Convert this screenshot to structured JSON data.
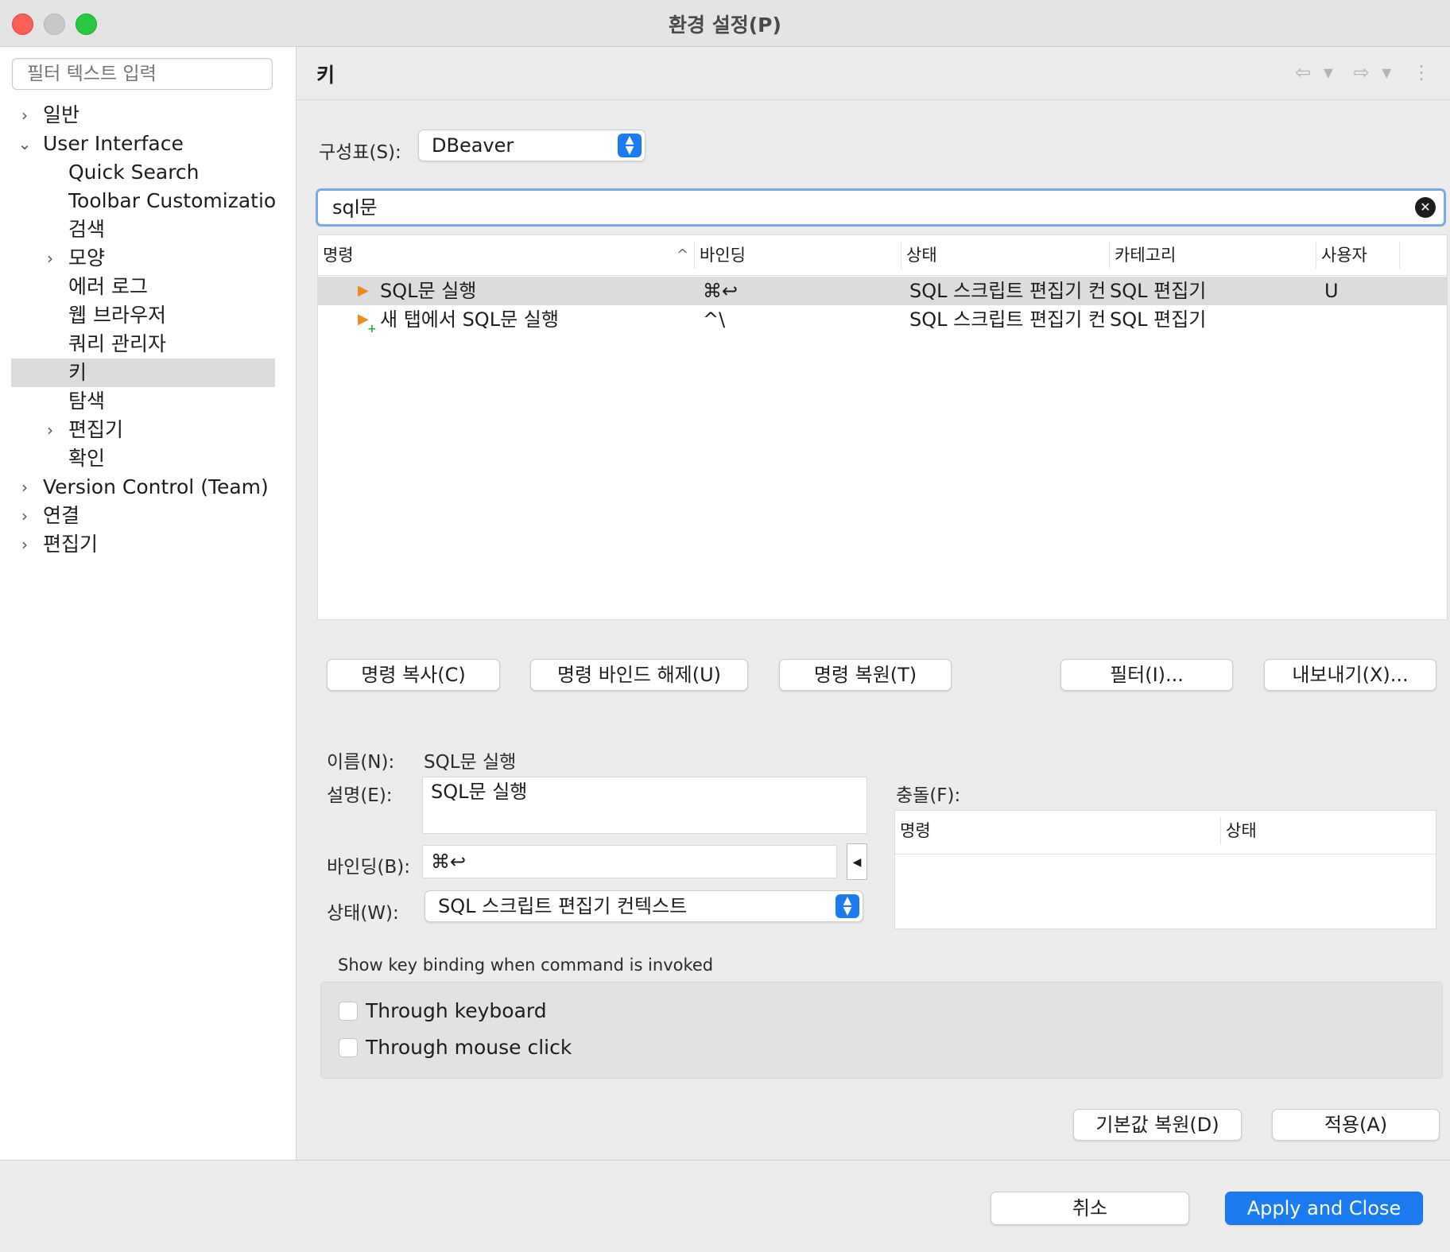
{
  "window": {
    "title": "환경 설정(P)"
  },
  "sidebar": {
    "filter_placeholder": "필터 텍스트 입력",
    "items": [
      {
        "label": "일반",
        "level": 0,
        "chevron": "›"
      },
      {
        "label": "User Interface",
        "level": 0,
        "chevron": "⌄"
      },
      {
        "label": "Quick Search",
        "level": 1,
        "chevron": ""
      },
      {
        "label": "Toolbar Customization",
        "level": 1,
        "chevron": ""
      },
      {
        "label": "검색",
        "level": 1,
        "chevron": ""
      },
      {
        "label": "모양",
        "level": 1,
        "chevron": "›"
      },
      {
        "label": "에러 로그",
        "level": 1,
        "chevron": ""
      },
      {
        "label": "웹 브라우저",
        "level": 1,
        "chevron": ""
      },
      {
        "label": "쿼리 관리자",
        "level": 1,
        "chevron": ""
      },
      {
        "label": "키",
        "level": 1,
        "chevron": "",
        "selected": true
      },
      {
        "label": "탐색",
        "level": 1,
        "chevron": ""
      },
      {
        "label": "편집기",
        "level": 1,
        "chevron": "›"
      },
      {
        "label": "확인",
        "level": 1,
        "chevron": ""
      },
      {
        "label": "Version Control (Team)",
        "level": 0,
        "chevron": "›"
      },
      {
        "label": "연결",
        "level": 0,
        "chevron": "›"
      },
      {
        "label": "편집기",
        "level": 0,
        "chevron": "›"
      }
    ]
  },
  "main": {
    "title": "키",
    "nav": {
      "back": "⇦ ▾",
      "forward": "⇨ ▾",
      "more": "⋮"
    },
    "scheme": {
      "label": "구성표(S):",
      "value": "DBeaver"
    },
    "search": {
      "value": "sql문"
    },
    "table": {
      "columns": [
        "명령",
        "바인딩",
        "상태",
        "카테고리",
        "사용자"
      ],
      "sort_indicator": "^",
      "rows": [
        {
          "command": "SQL문 실행",
          "binding": "⌘↩",
          "when": "SQL 스크립트 편집기 컨",
          "category": "SQL 편집기",
          "user": "U",
          "selected": true,
          "plus": ""
        },
        {
          "command": "새 탭에서 SQL문 실행",
          "binding": "^\\",
          "when": "SQL 스크립트 편집기 컨",
          "category": "SQL 편집기",
          "user": "",
          "selected": false,
          "plus": "+"
        }
      ]
    },
    "buttons": {
      "copy": "명령 복사(C)",
      "unbind": "명령 바인드 해제(U)",
      "restore": "명령 복원(T)",
      "filter": "필터(I)...",
      "export": "내보내기(X)..."
    },
    "details": {
      "name_label": "이름(N):",
      "name_value": "SQL문 실행",
      "desc_label": "설명(E):",
      "desc_value": "SQL문 실행",
      "binding_label": "바인딩(B):",
      "binding_value": "⌘↩",
      "binding_menu_glyph": "◀",
      "when_label": "상태(W):",
      "when_value": "SQL 스크립트 편집기 컨텍스트",
      "conflicts_label": "충돌(F):",
      "conflict_columns": [
        "명령",
        "상태"
      ]
    },
    "show_binding": {
      "label": "Show key binding when command is invoked",
      "options": [
        "Through keyboard",
        "Through mouse click"
      ]
    },
    "restore_defaults": "기본값 복원(D)",
    "apply": "적용(A)"
  },
  "footer": {
    "cancel": "취소",
    "apply_close": "Apply and Close"
  }
}
